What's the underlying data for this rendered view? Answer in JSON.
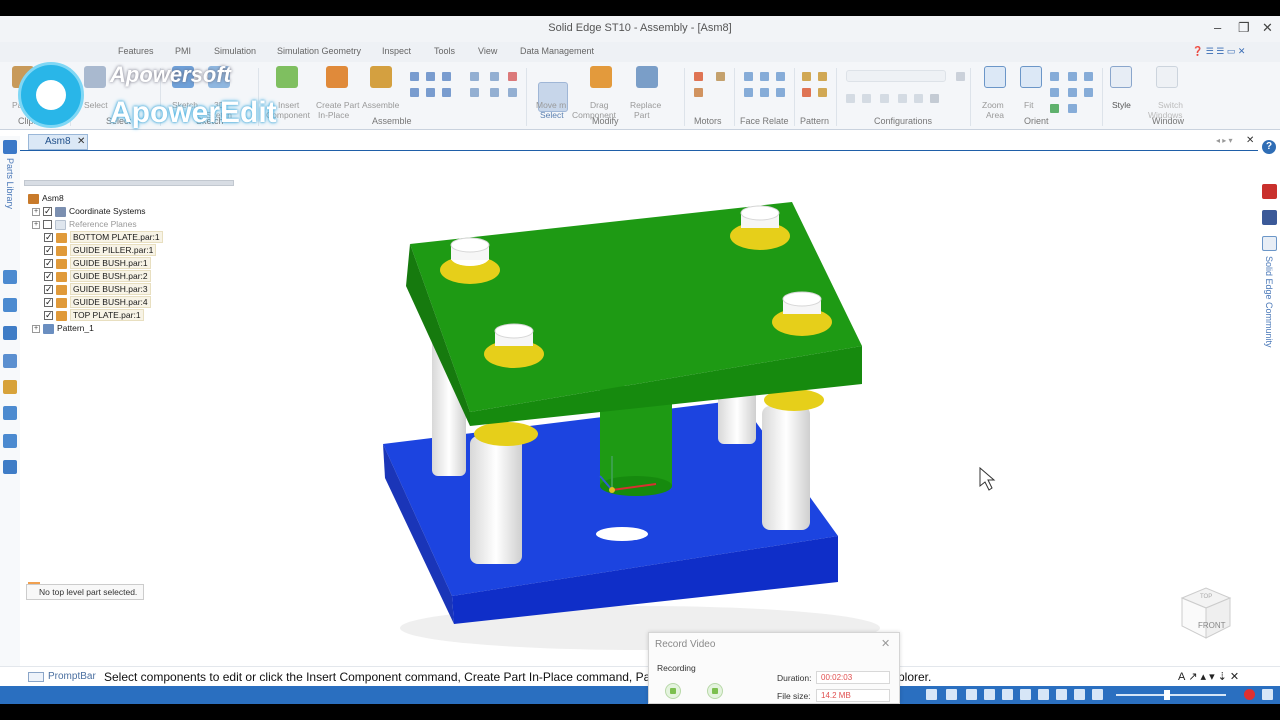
{
  "window": {
    "title": "Solid Edge ST10 - Assembly - [Asm8]",
    "controls": [
      "–",
      "❐",
      "✕"
    ]
  },
  "watermark": {
    "brand_top": "Apowersoft",
    "brand_main": "ApowerEdit"
  },
  "menu": {
    "items": [
      "Features",
      "PMI",
      "Simulation",
      "Simulation Geometry",
      "Inspect",
      "Tools",
      "View",
      "Data Management"
    ]
  },
  "ribbon": {
    "buttons": [
      {
        "label": "Paste",
        "sub": ""
      },
      {
        "label": "Select",
        "sub": ""
      },
      {
        "label": "Sketch",
        "sub": ""
      },
      {
        "label": "3D",
        "sub": "Sketch"
      },
      {
        "label": "Insert",
        "sub": "Component"
      },
      {
        "label": "Create Part",
        "sub": "In-Place"
      },
      {
        "label": "Assemble",
        "sub": ""
      },
      {
        "label": "Move m",
        "sub": "Select"
      },
      {
        "label": "Drag",
        "sub": "Component"
      },
      {
        "label": "Replace",
        "sub": "Part"
      },
      {
        "label": "Zoom",
        "sub": "Area"
      },
      {
        "label": "Fit",
        "sub": ""
      },
      {
        "label": "Style",
        "sub": ""
      },
      {
        "label": "Switch",
        "sub": "Windows"
      }
    ],
    "groups": [
      "Clipboard",
      "Select",
      "Sketch",
      "Assemble",
      "Modify",
      "Motors",
      "Face Relate",
      "Pattern",
      "Configurations",
      "Orient",
      "Window"
    ]
  },
  "document_tab": {
    "label": "Asm8",
    "close": "✕"
  },
  "left_strip": {
    "label": "Parts Library"
  },
  "right_strip": {
    "label": "Solid Edge Community"
  },
  "tree": {
    "root": "Asm8",
    "items": [
      {
        "label": "Coordinate Systems",
        "checked": true,
        "expandable": true
      },
      {
        "label": "Reference Planes",
        "checked": false,
        "expandable": true,
        "dim": true
      },
      {
        "label": "BOTTOM PLATE.par:1",
        "checked": true,
        "expandable": false
      },
      {
        "label": "GUIDE PILLER.par:1",
        "checked": true,
        "expandable": false
      },
      {
        "label": "GUIDE BUSH.par:1",
        "checked": true,
        "expandable": false
      },
      {
        "label": "GUIDE BUSH.par:2",
        "checked": true,
        "expandable": false
      },
      {
        "label": "GUIDE BUSH.par:3",
        "checked": true,
        "expandable": false
      },
      {
        "label": "GUIDE BUSH.par:4",
        "checked": true,
        "expandable": false
      },
      {
        "label": "TOP PLATE.par:1",
        "checked": true,
        "expandable": false
      },
      {
        "label": "Pattern_1",
        "checked": null,
        "expandable": true
      }
    ]
  },
  "status": {
    "message": "No top level part selected."
  },
  "prompt_bar": {
    "label": "PromptBar",
    "text": "Select components to edit or click the Insert Component command, Create Part In-Place command, Parts L",
    "text_tail": "plorer."
  },
  "viewcube": {
    "face": "FRONT",
    "top": "TOP"
  },
  "record_video": {
    "title": "Record Video",
    "status": "Recording",
    "duration_label": "Duration:",
    "duration_value": "00:02:03",
    "filesize_label": "File size:",
    "filesize_value": "14.2 MB"
  },
  "colors": {
    "top_plate": "#1e9a14",
    "bottom_plate": "#1438d6",
    "bush": "#e6cf1a",
    "pillar": "#f2f2f2",
    "taskbar": "#2a6fc0"
  }
}
